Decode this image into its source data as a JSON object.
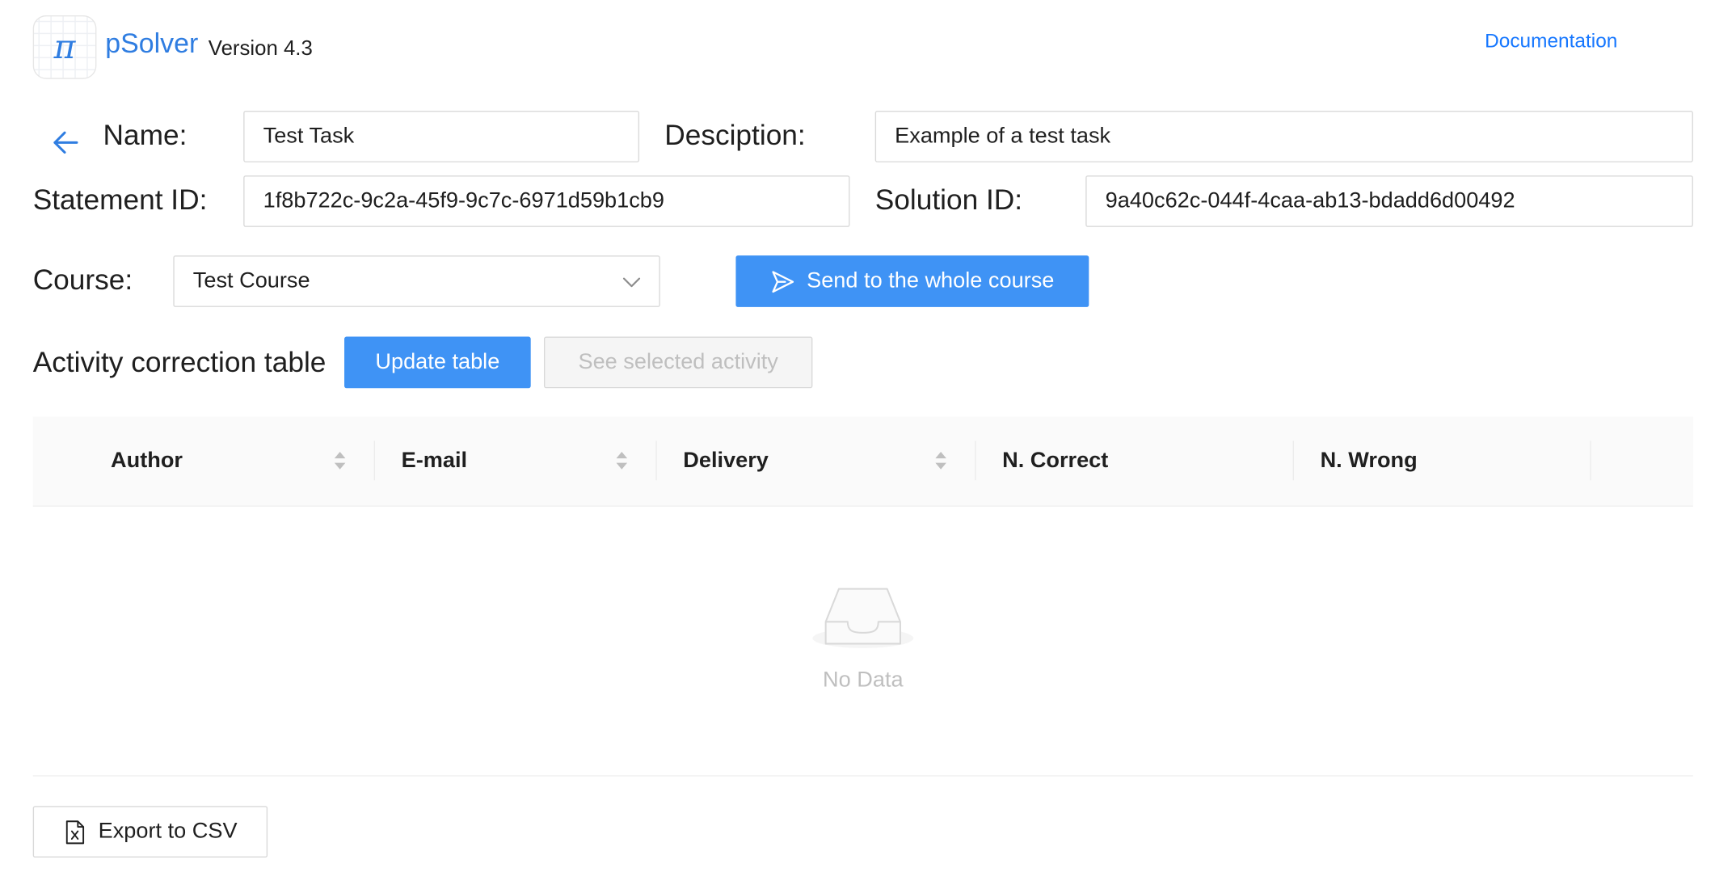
{
  "header": {
    "logo_glyph": "π",
    "app_name": "pSolver",
    "version": "Version 4.3",
    "documentation_link": "Documentation"
  },
  "form": {
    "name_label": "Name:",
    "name_value": "Test Task",
    "description_label": "Desciption:",
    "description_value": "Example of a test task",
    "statement_label": "Statement ID:",
    "statement_value": "1f8b722c-9c2a-45f9-9c7c-6971d59b1cb9",
    "solution_label": "Solution ID:",
    "solution_value": "9a40c62c-044f-4caa-ab13-bdadd6d00492",
    "course_label": "Course:",
    "course_value": "Test Course",
    "send_button": "Send to the whole course"
  },
  "activity": {
    "title": "Activity correction table",
    "update_button": "Update table",
    "see_button": "See selected activity"
  },
  "table": {
    "columns": [
      "Author",
      "E-mail",
      "Delivery",
      "N. Correct",
      "N. Wrong"
    ],
    "empty_text": "No Data"
  },
  "footer": {
    "export_button": "Export to CSV"
  },
  "colors": {
    "accent": "#3f93f5",
    "link": "#1677ff",
    "brand": "#2f7de1"
  },
  "icons": {
    "back": "arrow-left-icon",
    "send": "send-icon",
    "course_select": "chevron-down-icon",
    "sort": "sort-icon",
    "empty": "empty-inbox-icon",
    "export": "excel-file-icon"
  }
}
